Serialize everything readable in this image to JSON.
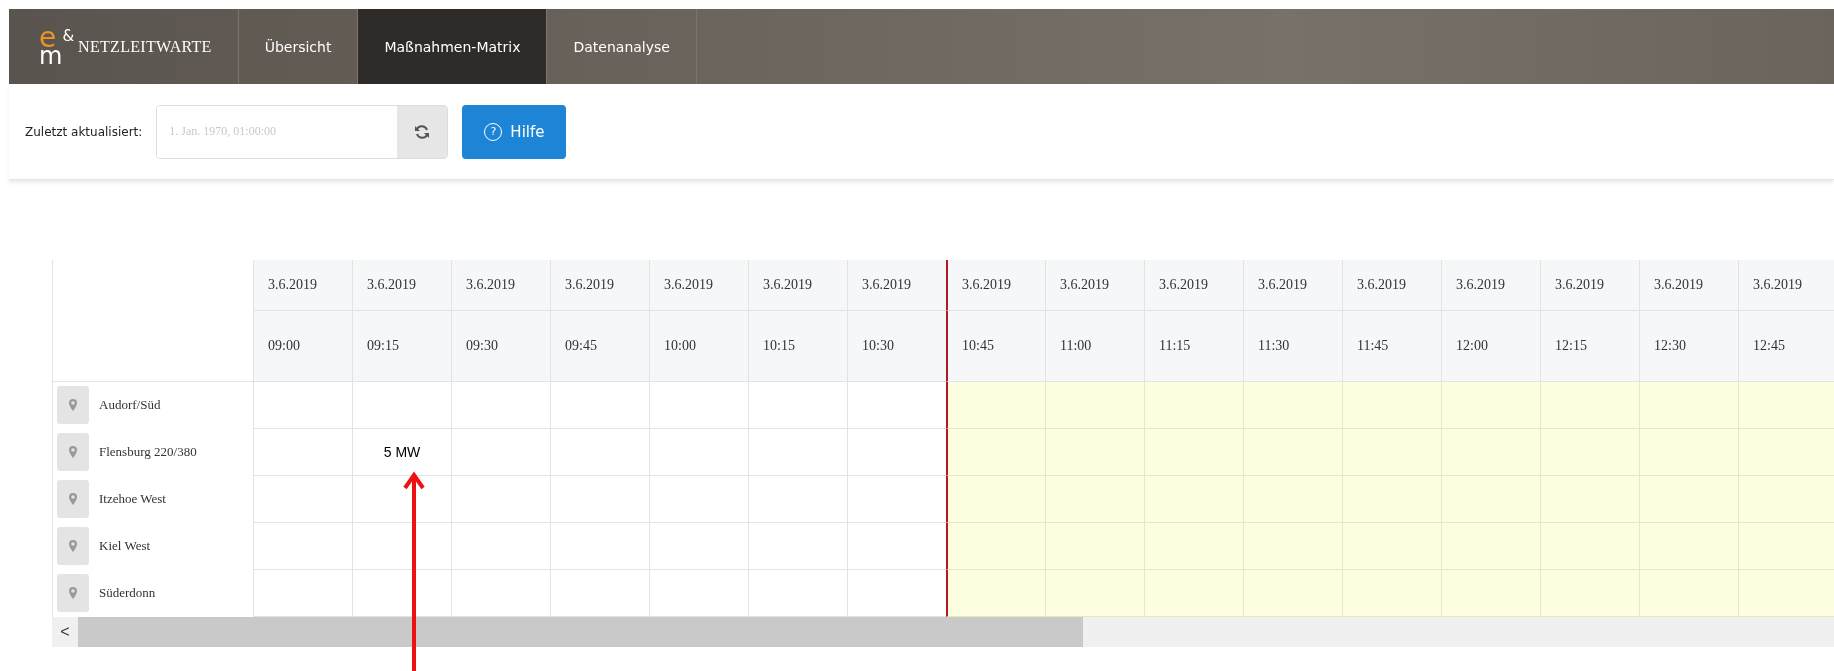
{
  "nav": {
    "logo_mark": "e",
    "logo_amp": "&",
    "logo_m": "m",
    "brand": "NETZLEITWARTE",
    "tabs": [
      {
        "label": "Übersicht",
        "selected": false
      },
      {
        "label": "Maßnahmen-Matrix",
        "selected": true
      },
      {
        "label": "Datenanalyse",
        "selected": false
      }
    ]
  },
  "toolbar": {
    "label": "Zuletzt aktualisiert:",
    "placeholder": "1. Jan. 1970, 01:00:00",
    "help_icon": "?",
    "help_label": "Hilfe"
  },
  "matrix": {
    "columns": [
      {
        "date": "3.6.2019",
        "time": "09:00",
        "forecast": false
      },
      {
        "date": "3.6.2019",
        "time": "09:15",
        "forecast": false
      },
      {
        "date": "3.6.2019",
        "time": "09:30",
        "forecast": false
      },
      {
        "date": "3.6.2019",
        "time": "09:45",
        "forecast": false
      },
      {
        "date": "3.6.2019",
        "time": "10:00",
        "forecast": false
      },
      {
        "date": "3.6.2019",
        "time": "10:15",
        "forecast": false
      },
      {
        "date": "3.6.2019",
        "time": "10:30",
        "forecast": false
      },
      {
        "date": "3.6.2019",
        "time": "10:45",
        "forecast": true
      },
      {
        "date": "3.6.2019",
        "time": "11:00",
        "forecast": true
      },
      {
        "date": "3.6.2019",
        "time": "11:15",
        "forecast": true
      },
      {
        "date": "3.6.2019",
        "time": "11:30",
        "forecast": true
      },
      {
        "date": "3.6.2019",
        "time": "11:45",
        "forecast": true
      },
      {
        "date": "3.6.2019",
        "time": "12:00",
        "forecast": true
      },
      {
        "date": "3.6.2019",
        "time": "12:15",
        "forecast": true
      },
      {
        "date": "3.6.2019",
        "time": "12:30",
        "forecast": true
      },
      {
        "date": "3.6.2019",
        "time": "12:45",
        "forecast": true
      }
    ],
    "rows": [
      {
        "name": "Audorf/Süd",
        "cells": []
      },
      {
        "name": "Flensburg 220/380",
        "cells": [
          "",
          "5 MW"
        ]
      },
      {
        "name": "Itzehoe West",
        "cells": []
      },
      {
        "name": "Kiel West",
        "cells": []
      },
      {
        "name": "Süderdonn",
        "cells": []
      }
    ],
    "scroll_left": "<"
  }
}
